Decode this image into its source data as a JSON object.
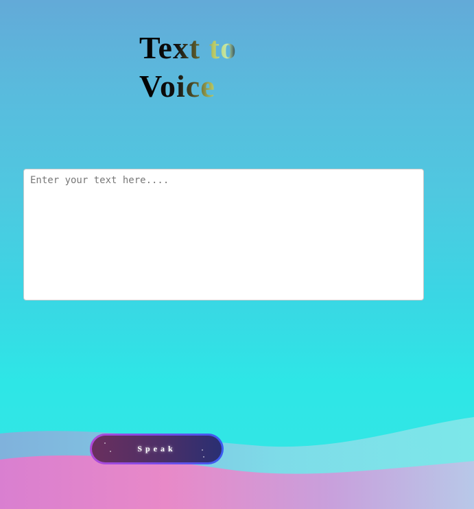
{
  "header": {
    "title": "Text to Voice"
  },
  "input": {
    "placeholder": "Enter your text here....",
    "value": ""
  },
  "actions": {
    "speak_label": "Speak"
  },
  "colors": {
    "title_gradient": [
      "#000000",
      "#5a5a2c",
      "#b9c864",
      "#12304a",
      "#3a2a8e",
      "#d14a9a",
      "#f08070"
    ],
    "button_border": [
      "#b04ad8",
      "#3a5cf0"
    ],
    "button_fill": [
      "#6a2f5e",
      "#2a2f72"
    ],
    "background_top": "#63aad8",
    "background_bottom": "#2ee6e6"
  }
}
